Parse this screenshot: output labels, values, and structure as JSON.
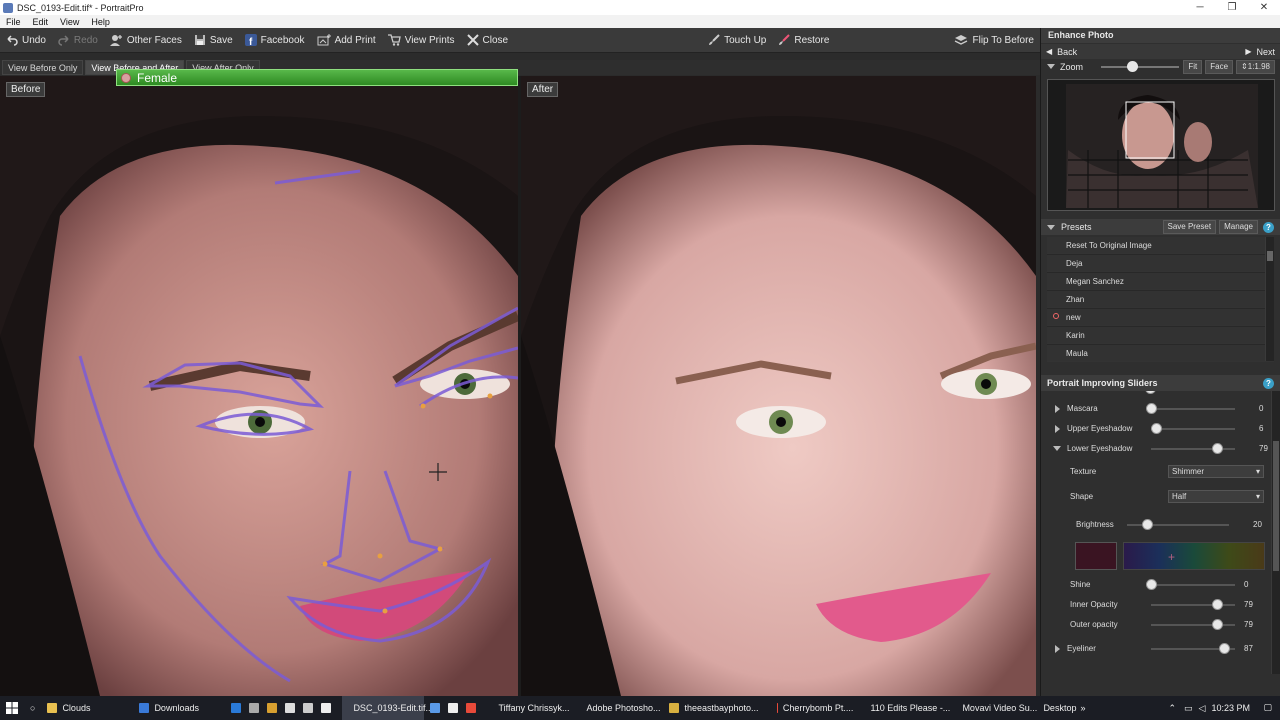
{
  "window": {
    "title": "DSC_0193-Edit.tif* - PortraitPro"
  },
  "menu": [
    "File",
    "Edit",
    "View",
    "Help"
  ],
  "toolbar": {
    "undo": "Undo",
    "redo": "Redo",
    "other_faces": "Other Faces",
    "save": "Save",
    "facebook": "Facebook",
    "add_print": "Add Print",
    "view_prints": "View Prints",
    "close": "Close",
    "touch_up": "Touch Up",
    "restore": "Restore",
    "flip": "Flip To Before"
  },
  "view_tabs": [
    "View Before Only",
    "View Before and After",
    "View After Only"
  ],
  "panes": {
    "before_label": "Before",
    "after_label": "After",
    "gender_label": "Female"
  },
  "enhance": {
    "header": "Enhance Photo",
    "back": "Back",
    "next": "Next",
    "zoom_label": "Zoom",
    "fit": "Fit",
    "face": "Face",
    "zoom_value": "1:1.98"
  },
  "presets": {
    "header": "Presets",
    "save_preset": "Save Preset",
    "manage": "Manage",
    "items": [
      "Reset To Original Image",
      "Deja",
      "Megan Sanchez",
      "Zhan",
      "new",
      "Karin",
      "Maula"
    ]
  },
  "sliders": {
    "header": "Portrait Improving Sliders",
    "mascara": {
      "label": "Mascara",
      "value": "0",
      "fraction": 0.0
    },
    "upper_eyeshadow": {
      "label": "Upper Eyeshadow",
      "value": "6",
      "fraction": 0.06
    },
    "lower_eyeshadow": {
      "label": "Lower Eyeshadow",
      "value": "79",
      "fraction": 0.79
    },
    "texture": {
      "label": "Texture",
      "value": "Shimmer"
    },
    "shape": {
      "label": "Shape",
      "value": "Half"
    },
    "brightness": {
      "label": "Brightness",
      "value": "20",
      "fraction": 0.2
    },
    "shine": {
      "label": "Shine",
      "value": "0",
      "fraction": 0.0
    },
    "inner_opacity": {
      "label": "Inner Opacity",
      "value": "79",
      "fraction": 0.79
    },
    "outer_opacity": {
      "label": "Outer opacity",
      "value": "79",
      "fraction": 0.79
    },
    "eyeliner": {
      "label": "Eyeliner",
      "value": "87",
      "fraction": 0.87
    }
  },
  "taskbar": {
    "items": [
      "Clouds",
      "Downloads",
      "DSC_0193-Edit.tif...",
      "Tiffany Chrissyk...",
      "Adobe Photosho...",
      "theeastbayphoto...",
      "Cherrybomb Pt....",
      "110 Edits Please -...",
      "Movavi Video Su..."
    ],
    "desktop": "Desktop",
    "clock": "10:23 PM"
  },
  "colors": {
    "accent_green": "#3a9a2c",
    "help_blue": "#3aa0c8",
    "overlay_purple": "#7b5cd6"
  }
}
